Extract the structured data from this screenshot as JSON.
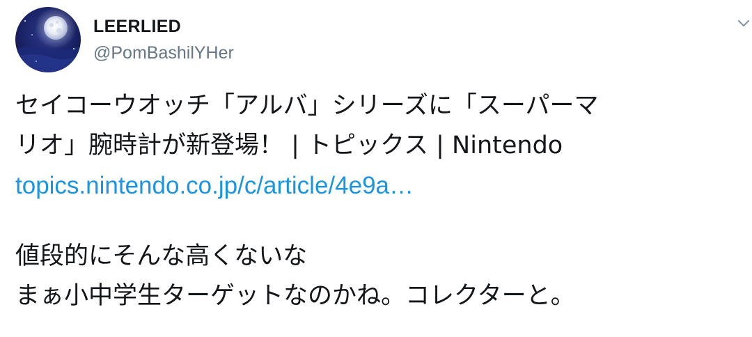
{
  "author": {
    "display_name": "LEERLIED",
    "handle": "@PomBashilYHer"
  },
  "tweet": {
    "line1": "セイコーウオッチ「アルバ」シリーズに「スーパーマ",
    "line2": "リオ」腕時計が新登場！ | トピックス | Nintendo",
    "link": "topics.nintendo.co.jp/c/article/4e9a…",
    "line3": "値段的にそんな高くないな",
    "line4": "まぁ小中学生ターゲットなのかね。コレクターと。"
  },
  "colors": {
    "link": "#1b95e0",
    "handle": "#657786",
    "text": "#14171a"
  },
  "icons": {
    "avatar": "full-moon-night-sky",
    "menu": "chevron-down-icon"
  }
}
